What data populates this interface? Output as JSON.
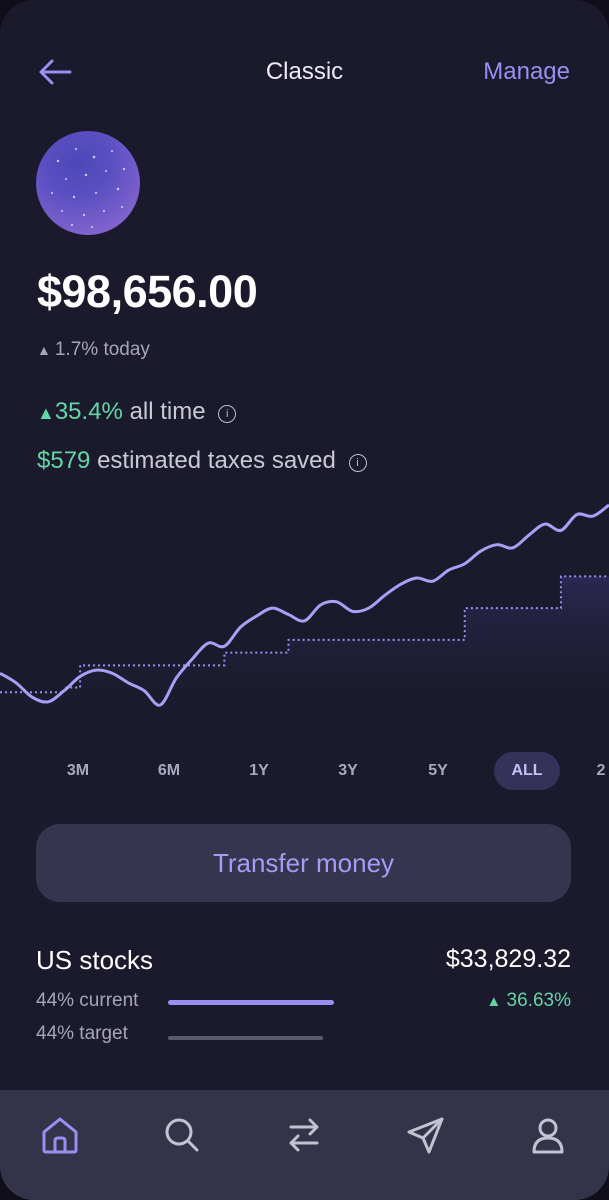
{
  "header": {
    "title": "Classic",
    "manage_label": "Manage"
  },
  "portfolio": {
    "balance": "$98,656.00",
    "today_change": "1.7% today",
    "alltime_pct": "35.4%",
    "alltime_label": "all time",
    "taxes_amount": "$579",
    "taxes_label": "estimated taxes saved",
    "info_glyph": "i"
  },
  "chart_data": {
    "type": "line",
    "series": [
      {
        "values": [
          39,
          33,
          24,
          21,
          28,
          37,
          41,
          39,
          33,
          28,
          19,
          36,
          48,
          58,
          56,
          68,
          75,
          80,
          76,
          72,
          82,
          84,
          78,
          80,
          88,
          95,
          99,
          97,
          104,
          108,
          116,
          120,
          118,
          126,
          133,
          129,
          139,
          138,
          145
        ]
      },
      {
        "values": [
          27,
          27,
          27,
          27,
          30,
          44,
          44,
          44,
          44,
          44,
          44,
          44,
          44,
          44,
          52,
          52,
          52,
          52,
          60,
          60,
          60,
          60,
          60,
          60,
          60,
          60,
          60,
          60,
          60,
          80,
          80,
          80,
          80,
          80,
          80,
          100,
          100,
          100,
          100
        ]
      }
    ],
    "grid": false,
    "legend": "none"
  },
  "ranges": {
    "items": [
      "3M",
      "6M",
      "1Y",
      "3Y",
      "5Y",
      "ALL",
      "2"
    ],
    "active": "ALL"
  },
  "transfer_label": "Transfer money",
  "allocation": {
    "title": "US stocks",
    "value": "$33,829.32",
    "current_label": "44% current",
    "target_label": "44% target",
    "change": "36.63%",
    "current_pct": 44,
    "target_pct": 44
  },
  "nav": {
    "items": [
      "home-icon",
      "search-icon",
      "transfer-arrows-icon",
      "send-icon",
      "profile-icon"
    ]
  },
  "colors": {
    "accent": "#9a8ff0",
    "positive": "#63d6a6",
    "background": "#1b1a2c",
    "nav": "#33334a"
  }
}
